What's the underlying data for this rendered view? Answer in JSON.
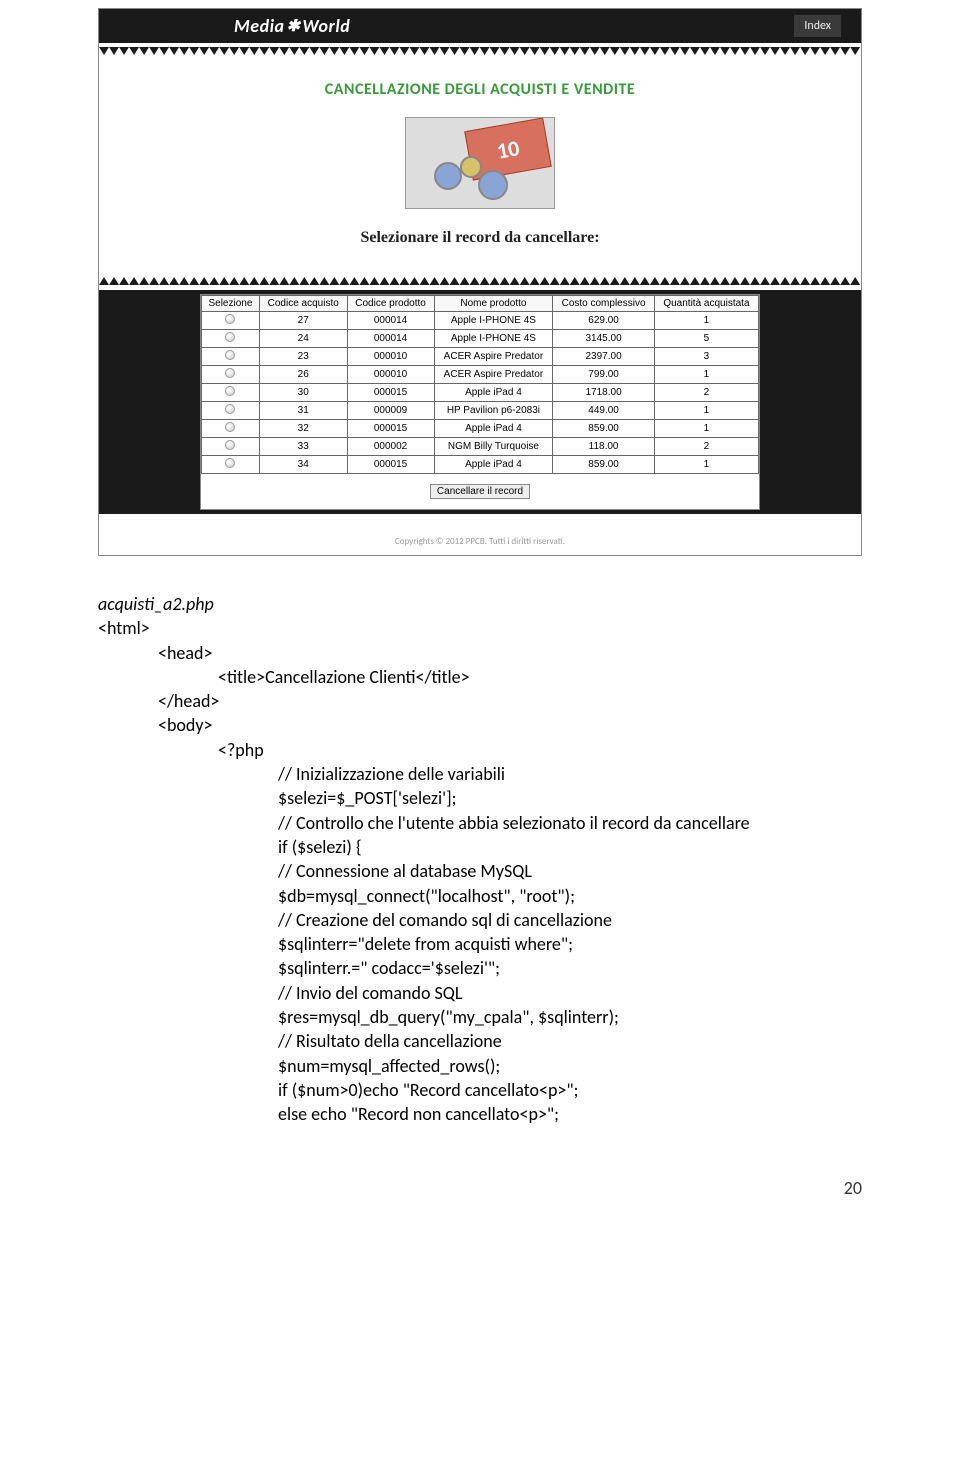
{
  "topbar": {
    "logo_prefix": "Media",
    "logo_suffix": "World",
    "index_label": "Index"
  },
  "screenshot": {
    "title": "CANCELLAZIONE DEGLI ACQUISTI E VENDITE",
    "subtitle": "Selezionare il record da cancellare:",
    "money_note": "10",
    "table": {
      "headers": [
        "Selezione",
        "Codice acquisto",
        "Codice prodotto",
        "Nome prodotto",
        "Costo complessivo",
        "Quantità acquistata"
      ],
      "rows": [
        [
          "27",
          "000014",
          "Apple I-PHONE 4S",
          "629.00",
          "1"
        ],
        [
          "24",
          "000014",
          "Apple I-PHONE 4S",
          "3145.00",
          "5"
        ],
        [
          "23",
          "000010",
          "ACER Aspire Predator",
          "2397.00",
          "3"
        ],
        [
          "26",
          "000010",
          "ACER Aspire Predator",
          "799.00",
          "1"
        ],
        [
          "30",
          "000015",
          "Apple iPad 4",
          "1718.00",
          "2"
        ],
        [
          "31",
          "000009",
          "HP Pavilion p6-2083i",
          "449.00",
          "1"
        ],
        [
          "32",
          "000015",
          "Apple iPad 4",
          "859.00",
          "1"
        ],
        [
          "33",
          "000002",
          "NGM Billy Turquoise",
          "118.00",
          "2"
        ],
        [
          "34",
          "000015",
          "Apple iPad 4",
          "859.00",
          "1"
        ]
      ]
    },
    "cancel_button": "Cancellare il record",
    "copyright": "Copyrights © 2012 PPCB. Tutti i diritti riservati."
  },
  "code": {
    "filename": "acquisti_a2.php",
    "l1": "<html>",
    "l2": "<head>",
    "l3": "<title>Cancellazione Clienti</title>",
    "l4": "</head>",
    "l5": "<body>",
    "l6": "<?php",
    "l7": "// Inizializzazione delle variabili",
    "l8": "$selezi=$_POST['selezi'];",
    "l9": "// Controllo che l'utente abbia selezionato il record da cancellare",
    "l10": "if ($selezi) {",
    "l11": "// Connessione al database MySQL",
    "l12": "$db=mysql_connect(\"localhost\", \"root\");",
    "l13": "// Creazione del comando sql di cancellazione",
    "l14": "$sqlinterr=\"delete from acquisti where\";",
    "l15": "$sqlinterr.=\" codacc='$selezi'\";",
    "l16": "// Invio del comando SQL",
    "l17": "$res=mysql_db_query(\"my_cpala\", $sqlinterr);",
    "l18": "// Risultato della cancellazione",
    "l19": "$num=mysql_affected_rows();",
    "l20": "if ($num>0)echo \"Record cancellato<p>\";",
    "l21": "else echo \"Record non cancellato<p>\";"
  },
  "page_number": "20"
}
